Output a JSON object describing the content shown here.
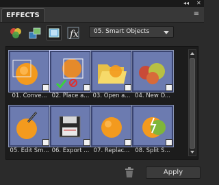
{
  "panel": {
    "tab_label": "EFFECTS",
    "titlebar_controls": [
      "◂◂",
      "✕"
    ],
    "menu_icon": "panel-menu-icon"
  },
  "toolbar": {
    "tools": [
      {
        "name": "filters-tool",
        "icon": "filters-icon",
        "selected": false
      },
      {
        "name": "layer-styles-tool",
        "icon": "layer-styles-icon",
        "selected": false
      },
      {
        "name": "photo-effects-tool",
        "icon": "photo-effects-icon",
        "selected": true
      },
      {
        "name": "text-effects-tool",
        "icon": "text-effects-icon",
        "selected": false
      }
    ],
    "category": "05. Smart Objects"
  },
  "effects": [
    {
      "label": "01. Conve...",
      "icon": "orange-convert-icon"
    },
    {
      "label": "02. Place a...",
      "icon": "place-icon",
      "selected": true
    },
    {
      "label": "03. Open a...",
      "icon": "folder-open-icon"
    },
    {
      "label": "04. New O...",
      "icon": "new-object-icon"
    },
    {
      "label": "05. Edit Sm...",
      "icon": "edit-smart-icon"
    },
    {
      "label": "06. Export ...",
      "icon": "export-floppy-icon"
    },
    {
      "label": "07. Replac...",
      "icon": "replace-icon"
    },
    {
      "label": "08. Split S...",
      "icon": "split-icon"
    }
  ],
  "footer": {
    "apply_label": "Apply",
    "trash_icon": "trash-icon"
  }
}
